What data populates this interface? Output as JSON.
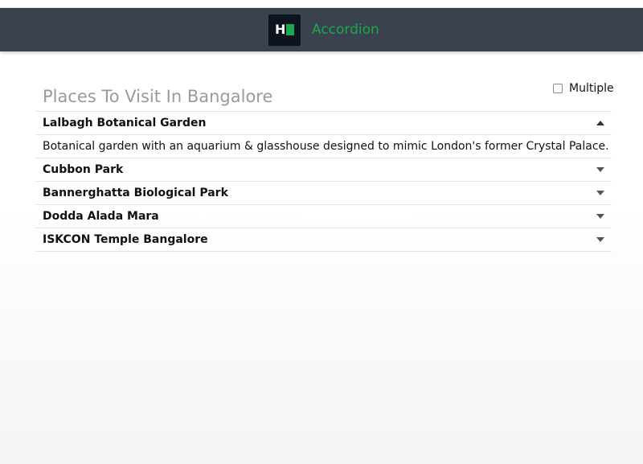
{
  "navbar": {
    "logo_letter": "H",
    "title": "Accordion",
    "accent_color": "#1ba94c",
    "background_color": "#39424e"
  },
  "page": {
    "heading": "Places To Visit In Bangalore"
  },
  "controls": {
    "multiple_label": "Multiple",
    "multiple_checked": false
  },
  "accordion": {
    "items": [
      {
        "title": "Lalbagh Botanical Garden",
        "expanded": true,
        "caret_icon": "caret-up-icon",
        "content": "Botanical garden with an aquarium & glasshouse designed to mimic London's former Crystal Palace."
      },
      {
        "title": "Cubbon Park",
        "expanded": false,
        "caret_icon": "caret-down-icon"
      },
      {
        "title": "Bannerghatta Biological Park",
        "expanded": false,
        "caret_icon": "caret-down-icon"
      },
      {
        "title": "Dodda Alada Mara",
        "expanded": false,
        "caret_icon": "caret-down-icon"
      },
      {
        "title": "ISKCON Temple Bangalore",
        "expanded": false,
        "caret_icon": "caret-down-icon"
      }
    ]
  }
}
